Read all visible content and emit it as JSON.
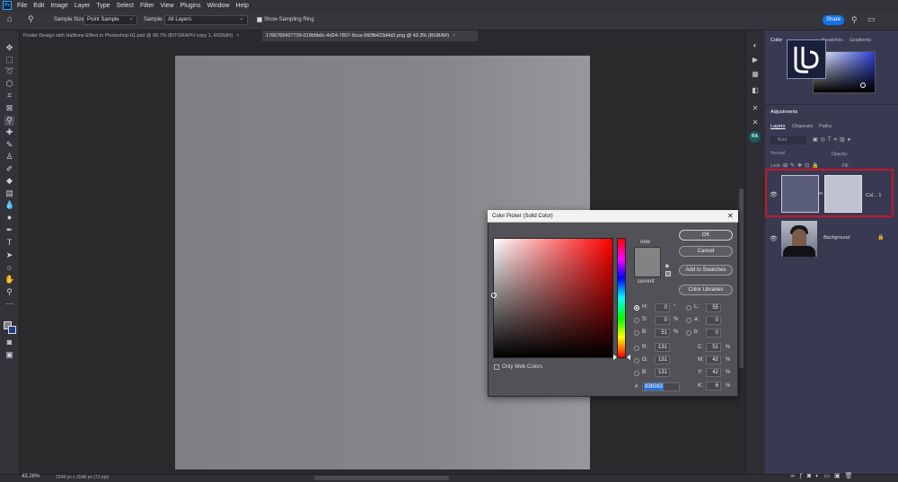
{
  "app": {
    "logo": "Ps"
  },
  "menu": [
    "File",
    "Edit",
    "Image",
    "Layer",
    "Type",
    "Select",
    "Filter",
    "View",
    "Plugins",
    "Window",
    "Help"
  ],
  "options": {
    "sample_size_label": "Sample Size:",
    "sample_size_value": "Point Sample",
    "sample_label": "Sample:",
    "sample_value": "All Layers",
    "show_ring_label": "Show Sampling Ring",
    "share_label": "Share"
  },
  "tabs": [
    {
      "label": "Poster Design with Halftone Effect in Photoshop-01.psd @ 58.7% (BITGRAPH copy 1, RGB/8#)",
      "close": "×",
      "active": false
    },
    {
      "label": "1766765427739-019b5b6c-4d24-7807-9cca-560fb423d4d2.png @ 43.3% (RGB/8#)",
      "close": "×",
      "active": true
    }
  ],
  "status": {
    "zoom": "43.26%",
    "doc_info": "2048 px x 2048 px (72 ppi)"
  },
  "panels": {
    "color_tabs": [
      "Color",
      "Swatches",
      "Gradients"
    ],
    "adjustments_title": "Adjustments",
    "layer_tabs": [
      "Layers",
      "Channels",
      "Paths"
    ],
    "kind_placeholder": "Kind",
    "mode_value": "Normal",
    "opacity_label": "Opacity:",
    "lock_label": "Lock:",
    "fill_label": "Fill:",
    "layers": [
      {
        "name": "Col... 1"
      },
      {
        "name": "Background",
        "lock": "🔒"
      }
    ],
    "ra_label": "RA"
  },
  "dialog": {
    "title": "Color Picker (Solid Color)",
    "new_label": "new",
    "current_label": "current",
    "ok_label": "OK",
    "cancel_label": "Cancel",
    "add_swatches_label": "Add to Swatches",
    "color_libraries_label": "Color Libraries",
    "only_web_label": "Only Web Colors",
    "hsb": {
      "H": "0",
      "S": "0",
      "B": "51",
      "h_unit": "°",
      "s_unit": "%",
      "b_unit": "%"
    },
    "rgb": {
      "R": "131",
      "G": "131",
      "B": "131"
    },
    "lab": {
      "L": "55",
      "a": "0",
      "b": "0"
    },
    "cmyk": {
      "C": "51",
      "M": "42",
      "Y": "42",
      "K": "6",
      "unit": "%"
    },
    "hex_label": "#",
    "hex": "838383",
    "swatch_color": "#838383"
  }
}
